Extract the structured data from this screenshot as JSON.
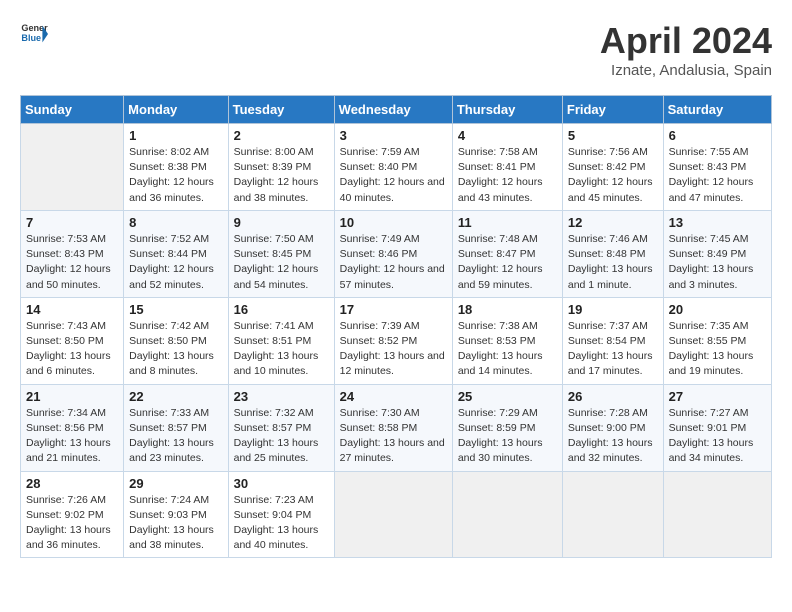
{
  "header": {
    "logo_general": "General",
    "logo_blue": "Blue",
    "title": "April 2024",
    "subtitle": "Iznate, Andalusia, Spain"
  },
  "calendar": {
    "days_of_week": [
      "Sunday",
      "Monday",
      "Tuesday",
      "Wednesday",
      "Thursday",
      "Friday",
      "Saturday"
    ],
    "weeks": [
      [
        {
          "day": "",
          "sunrise": "",
          "sunset": "",
          "daylight": "",
          "empty": true
        },
        {
          "day": "1",
          "sunrise": "Sunrise: 8:02 AM",
          "sunset": "Sunset: 8:38 PM",
          "daylight": "Daylight: 12 hours and 36 minutes.",
          "empty": false
        },
        {
          "day": "2",
          "sunrise": "Sunrise: 8:00 AM",
          "sunset": "Sunset: 8:39 PM",
          "daylight": "Daylight: 12 hours and 38 minutes.",
          "empty": false
        },
        {
          "day": "3",
          "sunrise": "Sunrise: 7:59 AM",
          "sunset": "Sunset: 8:40 PM",
          "daylight": "Daylight: 12 hours and 40 minutes.",
          "empty": false
        },
        {
          "day": "4",
          "sunrise": "Sunrise: 7:58 AM",
          "sunset": "Sunset: 8:41 PM",
          "daylight": "Daylight: 12 hours and 43 minutes.",
          "empty": false
        },
        {
          "day": "5",
          "sunrise": "Sunrise: 7:56 AM",
          "sunset": "Sunset: 8:42 PM",
          "daylight": "Daylight: 12 hours and 45 minutes.",
          "empty": false
        },
        {
          "day": "6",
          "sunrise": "Sunrise: 7:55 AM",
          "sunset": "Sunset: 8:43 PM",
          "daylight": "Daylight: 12 hours and 47 minutes.",
          "empty": false
        }
      ],
      [
        {
          "day": "7",
          "sunrise": "Sunrise: 7:53 AM",
          "sunset": "Sunset: 8:43 PM",
          "daylight": "Daylight: 12 hours and 50 minutes.",
          "empty": false
        },
        {
          "day": "8",
          "sunrise": "Sunrise: 7:52 AM",
          "sunset": "Sunset: 8:44 PM",
          "daylight": "Daylight: 12 hours and 52 minutes.",
          "empty": false
        },
        {
          "day": "9",
          "sunrise": "Sunrise: 7:50 AM",
          "sunset": "Sunset: 8:45 PM",
          "daylight": "Daylight: 12 hours and 54 minutes.",
          "empty": false
        },
        {
          "day": "10",
          "sunrise": "Sunrise: 7:49 AM",
          "sunset": "Sunset: 8:46 PM",
          "daylight": "Daylight: 12 hours and 57 minutes.",
          "empty": false
        },
        {
          "day": "11",
          "sunrise": "Sunrise: 7:48 AM",
          "sunset": "Sunset: 8:47 PM",
          "daylight": "Daylight: 12 hours and 59 minutes.",
          "empty": false
        },
        {
          "day": "12",
          "sunrise": "Sunrise: 7:46 AM",
          "sunset": "Sunset: 8:48 PM",
          "daylight": "Daylight: 13 hours and 1 minute.",
          "empty": false
        },
        {
          "day": "13",
          "sunrise": "Sunrise: 7:45 AM",
          "sunset": "Sunset: 8:49 PM",
          "daylight": "Daylight: 13 hours and 3 minutes.",
          "empty": false
        }
      ],
      [
        {
          "day": "14",
          "sunrise": "Sunrise: 7:43 AM",
          "sunset": "Sunset: 8:50 PM",
          "daylight": "Daylight: 13 hours and 6 minutes.",
          "empty": false
        },
        {
          "day": "15",
          "sunrise": "Sunrise: 7:42 AM",
          "sunset": "Sunset: 8:50 PM",
          "daylight": "Daylight: 13 hours and 8 minutes.",
          "empty": false
        },
        {
          "day": "16",
          "sunrise": "Sunrise: 7:41 AM",
          "sunset": "Sunset: 8:51 PM",
          "daylight": "Daylight: 13 hours and 10 minutes.",
          "empty": false
        },
        {
          "day": "17",
          "sunrise": "Sunrise: 7:39 AM",
          "sunset": "Sunset: 8:52 PM",
          "daylight": "Daylight: 13 hours and 12 minutes.",
          "empty": false
        },
        {
          "day": "18",
          "sunrise": "Sunrise: 7:38 AM",
          "sunset": "Sunset: 8:53 PM",
          "daylight": "Daylight: 13 hours and 14 minutes.",
          "empty": false
        },
        {
          "day": "19",
          "sunrise": "Sunrise: 7:37 AM",
          "sunset": "Sunset: 8:54 PM",
          "daylight": "Daylight: 13 hours and 17 minutes.",
          "empty": false
        },
        {
          "day": "20",
          "sunrise": "Sunrise: 7:35 AM",
          "sunset": "Sunset: 8:55 PM",
          "daylight": "Daylight: 13 hours and 19 minutes.",
          "empty": false
        }
      ],
      [
        {
          "day": "21",
          "sunrise": "Sunrise: 7:34 AM",
          "sunset": "Sunset: 8:56 PM",
          "daylight": "Daylight: 13 hours and 21 minutes.",
          "empty": false
        },
        {
          "day": "22",
          "sunrise": "Sunrise: 7:33 AM",
          "sunset": "Sunset: 8:57 PM",
          "daylight": "Daylight: 13 hours and 23 minutes.",
          "empty": false
        },
        {
          "day": "23",
          "sunrise": "Sunrise: 7:32 AM",
          "sunset": "Sunset: 8:57 PM",
          "daylight": "Daylight: 13 hours and 25 minutes.",
          "empty": false
        },
        {
          "day": "24",
          "sunrise": "Sunrise: 7:30 AM",
          "sunset": "Sunset: 8:58 PM",
          "daylight": "Daylight: 13 hours and 27 minutes.",
          "empty": false
        },
        {
          "day": "25",
          "sunrise": "Sunrise: 7:29 AM",
          "sunset": "Sunset: 8:59 PM",
          "daylight": "Daylight: 13 hours and 30 minutes.",
          "empty": false
        },
        {
          "day": "26",
          "sunrise": "Sunrise: 7:28 AM",
          "sunset": "Sunset: 9:00 PM",
          "daylight": "Daylight: 13 hours and 32 minutes.",
          "empty": false
        },
        {
          "day": "27",
          "sunrise": "Sunrise: 7:27 AM",
          "sunset": "Sunset: 9:01 PM",
          "daylight": "Daylight: 13 hours and 34 minutes.",
          "empty": false
        }
      ],
      [
        {
          "day": "28",
          "sunrise": "Sunrise: 7:26 AM",
          "sunset": "Sunset: 9:02 PM",
          "daylight": "Daylight: 13 hours and 36 minutes.",
          "empty": false
        },
        {
          "day": "29",
          "sunrise": "Sunrise: 7:24 AM",
          "sunset": "Sunset: 9:03 PM",
          "daylight": "Daylight: 13 hours and 38 minutes.",
          "empty": false
        },
        {
          "day": "30",
          "sunrise": "Sunrise: 7:23 AM",
          "sunset": "Sunset: 9:04 PM",
          "daylight": "Daylight: 13 hours and 40 minutes.",
          "empty": false
        },
        {
          "day": "",
          "sunrise": "",
          "sunset": "",
          "daylight": "",
          "empty": true
        },
        {
          "day": "",
          "sunrise": "",
          "sunset": "",
          "daylight": "",
          "empty": true
        },
        {
          "day": "",
          "sunrise": "",
          "sunset": "",
          "daylight": "",
          "empty": true
        },
        {
          "day": "",
          "sunrise": "",
          "sunset": "",
          "daylight": "",
          "empty": true
        }
      ]
    ]
  }
}
